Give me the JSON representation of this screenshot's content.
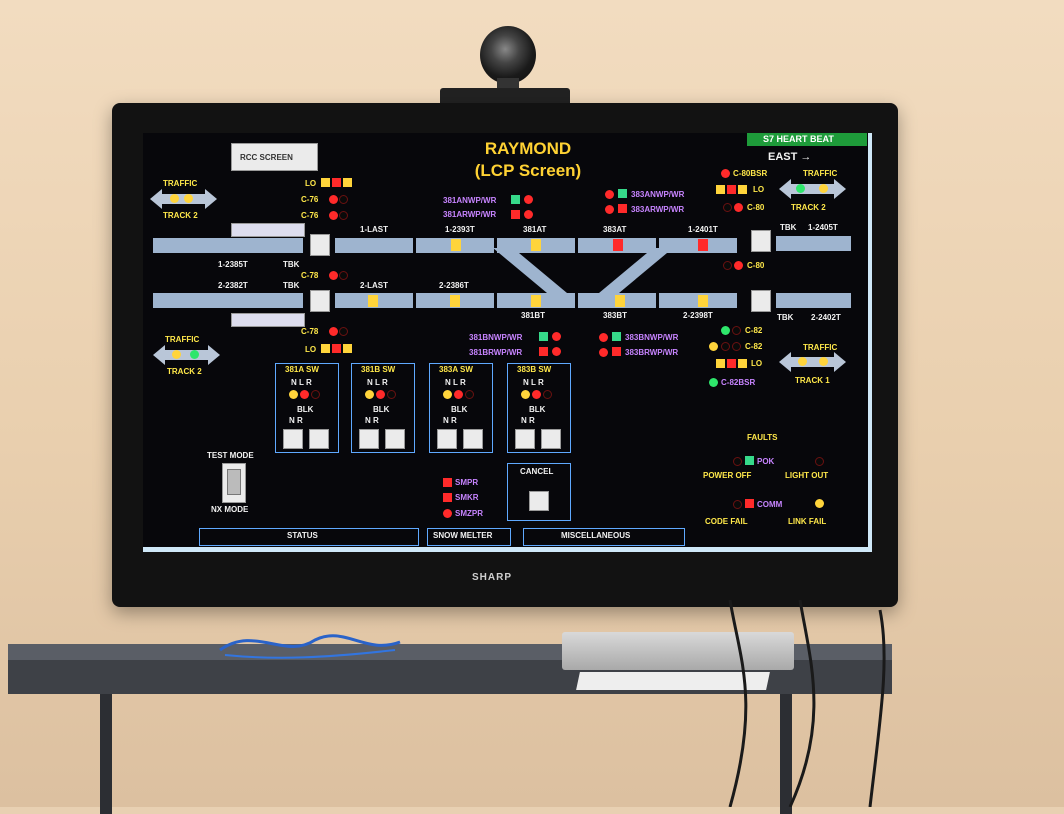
{
  "screen": {
    "title": "RAYMOND",
    "subtitle": "(LCP Screen)",
    "rcc_button": "RCC SCREEN",
    "heartbeat": "S7 HEART BEAT",
    "east": "EAST →",
    "traffic_left_top": {
      "label": "TRAFFIC",
      "track": "TRACK 2"
    },
    "traffic_left_bottom": {
      "label": "TRAFFIC",
      "track": "TRACK 2"
    },
    "traffic_right_top": {
      "label": "TRAFFIC",
      "track": "TRACK 2"
    },
    "traffic_right_bottom": {
      "label": "TRAFFIC",
      "track": "TRACK 1"
    },
    "signals": {
      "lo_top": "LO",
      "c76a": "C-76",
      "c76b": "C-76",
      "c78a": "C-78",
      "c78b": "C-78",
      "lo_bottom": "LO",
      "c80bsr": "C-80BSR",
      "lo_right": "LO",
      "c80a": "C-80",
      "c80b": "C-80",
      "c82a": "C-82",
      "c82b": "C-82",
      "lo_right_bottom": "LO",
      "c82bsr": "C-82BSR"
    },
    "switch_labels": {
      "s381anwp": "381ANWP/WR",
      "s381arwp": "381ARWP/WR",
      "s383anwp": "383ANWP/WR",
      "s383arwp": "383ARWP/WR",
      "s381bnwp": "381BNWP/WR",
      "s381brwp": "381BRWP/WR",
      "s383bnwp": "383BNWP/WR",
      "s383brwp": "383BRWP/WR"
    },
    "track_labels": {
      "t1_2385t": "1-2385T",
      "tbk_l1": "TBK",
      "t1_last": "1-LAST",
      "t1_2393t": "1-2393T",
      "t381at": "381AT",
      "t383at": "383AT",
      "t1_2401t": "1-2401T",
      "tbk_r1": "TBK",
      "t1_2405t": "1-2405T",
      "t2_2382t": "2-2382T",
      "tbk_l2": "TBK",
      "t2_last": "2-LAST",
      "t2_2386t": "2-2386T",
      "t381bt": "381BT",
      "t383bt": "383BT",
      "t2_2398t": "2-2398T",
      "tbk_r2": "TBK",
      "t2_2402t": "2-2402T"
    },
    "switch_panels": [
      {
        "title": "381A SW"
      },
      {
        "title": "381B SW"
      },
      {
        "title": "383A SW"
      },
      {
        "title": "383B SW"
      }
    ],
    "panel_nlr": "N L R",
    "panel_blk": "BLK",
    "panel_nr": "N R",
    "test_mode": "TEST MODE",
    "nx_mode": "NX MODE",
    "smpr": "SMPR",
    "smkr": "SMKR",
    "smzpr": "SMZPR",
    "cancel": "CANCEL",
    "faults": {
      "title": "FAULTS",
      "pok": "POK",
      "power_off": "POWER OFF",
      "light_out": "LIGHT OUT",
      "comm": "COMM",
      "code_fail": "CODE FAIL",
      "link_fail": "LINK FAIL"
    },
    "tabs": [
      "STATUS",
      "SNOW MELTER",
      "MISCELLANEOUS"
    ]
  },
  "tv_brand": "SHARP",
  "colors": {
    "amber": "#ffd233",
    "red": "#ff2a2a",
    "green": "#2ee66b",
    "track": "#9eb4cf",
    "purple": "#c784ff"
  }
}
